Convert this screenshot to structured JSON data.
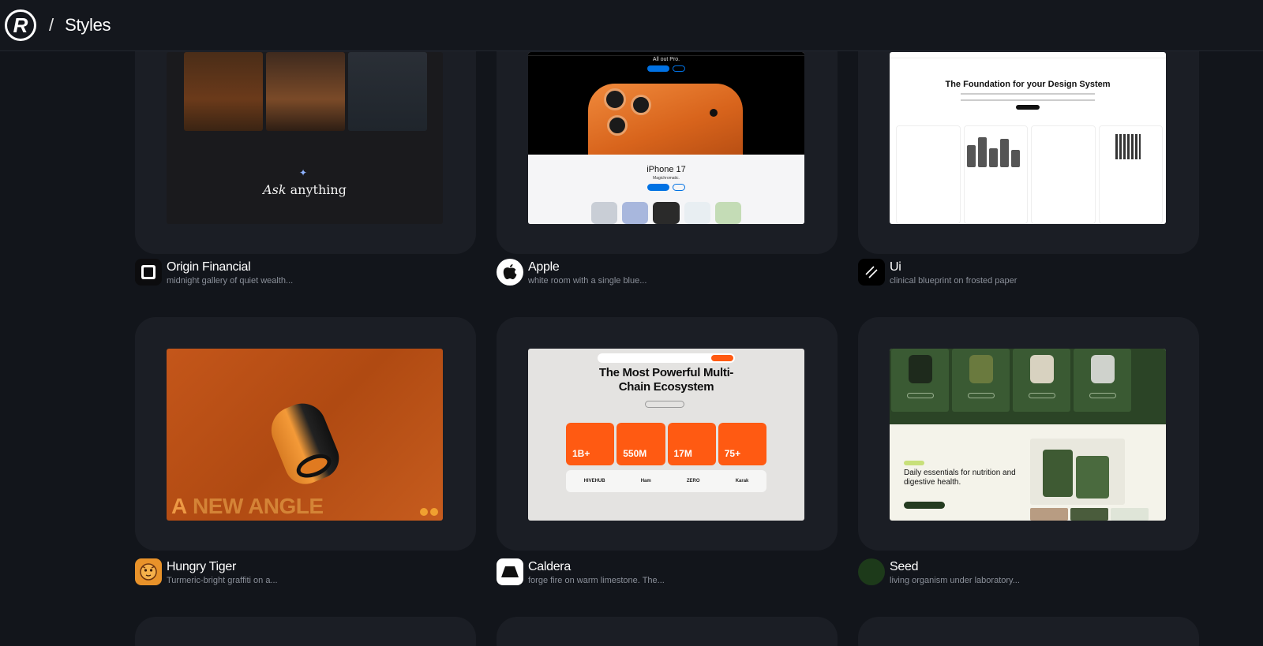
{
  "header": {
    "logo_letter": "R",
    "separator": "/",
    "title": "Styles"
  },
  "styles": [
    {
      "name": "Origin Financial",
      "description": "midnight gallery of quiet wealth...",
      "preview": {
        "headline_italic": "Ask",
        "headline": "anything"
      }
    },
    {
      "name": "Apple",
      "description": "white room with a single blue...",
      "preview": {
        "top_text": "All out Pro.",
        "product": "iPhone 17",
        "tagline": "Magichromatic."
      }
    },
    {
      "name": "Ui",
      "description": "clinical blueprint on frosted paper",
      "preview": {
        "headline": "The Foundation for your Design System"
      }
    },
    {
      "name": "Hungry Tiger",
      "description": "Turmeric-bright graffiti on a...",
      "preview": {
        "headline_accent": "A",
        "headline": "NEW ANGLE"
      }
    },
    {
      "name": "Caldera",
      "description": "forge fire on warm limestone. The...",
      "preview": {
        "headline": "The Most Powerful Multi-Chain Ecosystem",
        "stats": [
          "1B+",
          "550M",
          "17M",
          "75+"
        ],
        "logos": [
          "HIVEHUB",
          "Ham",
          "ZERO",
          "Karak"
        ]
      }
    },
    {
      "name": "Seed",
      "description": "living organism under laboratory...",
      "preview": {
        "headline": "Daily essentials for nutrition and digestive health."
      }
    }
  ],
  "colors": {
    "background": "#12151b",
    "card": "#1b1e25",
    "muted_text": "#8a8f99",
    "caldera_orange": "#ff5a12",
    "seed_green": "#2b4426",
    "tiger_orange": "#c4561a"
  },
  "icons": {
    "origin": "square-rounded-outline-icon",
    "apple": "apple-logo-icon",
    "ui": "double-slash-icon",
    "hungry_tiger": "tiger-face-icon",
    "caldera": "trapezoid-icon",
    "seed": "green-circle-icon"
  }
}
